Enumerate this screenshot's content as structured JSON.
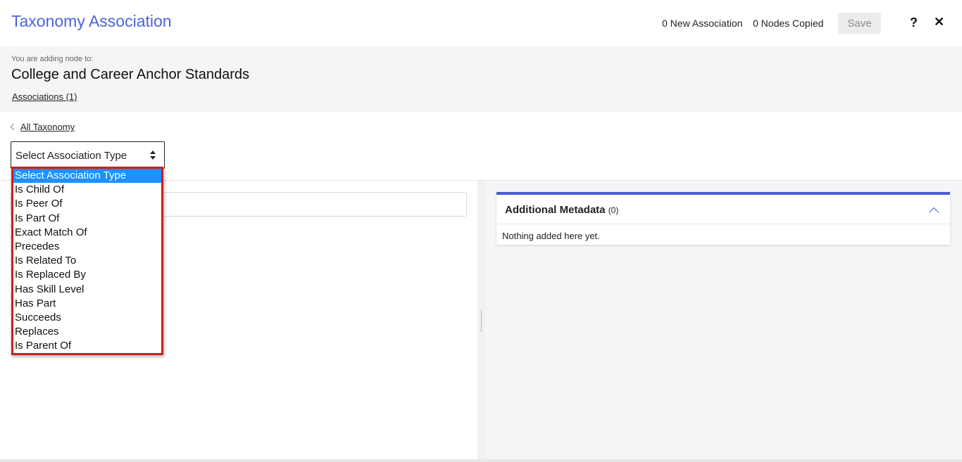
{
  "header": {
    "title": "Taxonomy Association",
    "new_association": "0 New Association",
    "nodes_copied": "0 Nodes Copied",
    "save_label": "Save",
    "help_label": "?",
    "close_label": "✕"
  },
  "context": {
    "adding_label": "You are adding node to:",
    "node_title": "College and Career Anchor Standards",
    "associations_link": "Associations (1)"
  },
  "nav": {
    "back_label": "All Taxonomy"
  },
  "association_select": {
    "selected": "Select Association Type",
    "options": [
      "Select Association Type",
      "Is Child Of",
      "Is Peer Of",
      "Is Part Of",
      "Exact Match Of",
      "Precedes",
      "Is Related To",
      "Is Replaced By",
      "Has Skill Level",
      "Has Part",
      "Succeeds",
      "Replaces",
      "Is Parent Of"
    ]
  },
  "metadata": {
    "title": "Additional Metadata",
    "count": "(0)",
    "empty_message": "Nothing added here yet."
  },
  "colors": {
    "accent": "#4d64d9",
    "dropdown_border": "#cc1f1f",
    "selected_option": "#1e90ff"
  }
}
